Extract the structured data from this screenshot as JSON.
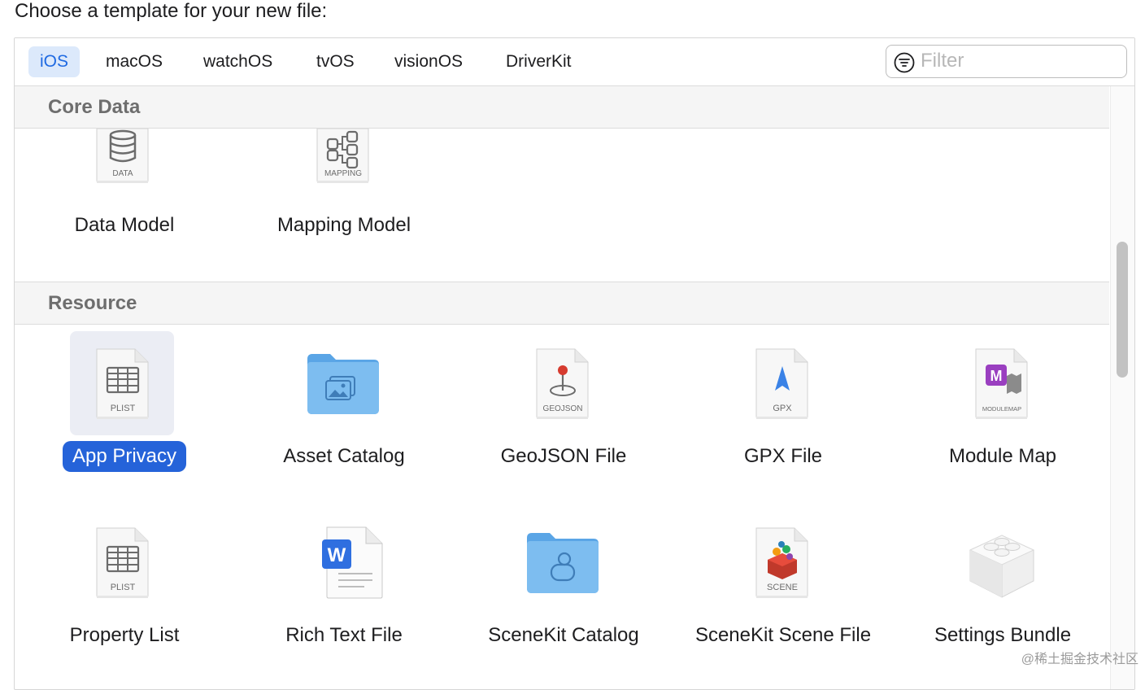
{
  "heading": "Choose a template for your new file:",
  "platform_tabs": [
    {
      "label": "iOS",
      "selected": true
    },
    {
      "label": "macOS",
      "selected": false
    },
    {
      "label": "watchOS",
      "selected": false
    },
    {
      "label": "tvOS",
      "selected": false
    },
    {
      "label": "visionOS",
      "selected": false
    },
    {
      "label": "DriverKit",
      "selected": false
    }
  ],
  "filter": {
    "placeholder": "Filter",
    "value": ""
  },
  "sections": [
    {
      "title": "Core Data",
      "items": [
        {
          "label": "Data Model",
          "icon": "data-document-icon",
          "icon_caption": "DATA"
        },
        {
          "label": "Mapping Model",
          "icon": "mapping-document-icon",
          "icon_caption": "MAPPING"
        }
      ]
    },
    {
      "title": "Resource",
      "items": [
        {
          "label": "App Privacy",
          "icon": "plist-document-icon",
          "icon_caption": "PLIST",
          "selected": true
        },
        {
          "label": "Asset Catalog",
          "icon": "asset-folder-icon"
        },
        {
          "label": "GeoJSON File",
          "icon": "geojson-document-icon",
          "icon_caption": "GEOJSON"
        },
        {
          "label": "GPX File",
          "icon": "gpx-document-icon",
          "icon_caption": "GPX"
        },
        {
          "label": "Module Map",
          "icon": "modulemap-document-icon",
          "icon_caption": "MODULEMAP"
        },
        {
          "label": "Property List",
          "icon": "plist-document-icon",
          "icon_caption": "PLIST"
        },
        {
          "label": "Rich Text File",
          "icon": "word-document-icon"
        },
        {
          "label": "SceneKit Catalog",
          "icon": "scenekit-folder-icon"
        },
        {
          "label": "SceneKit Scene File",
          "icon": "scene-document-icon",
          "icon_caption": "SCENE"
        },
        {
          "label": "Settings Bundle",
          "icon": "lego-brick-icon"
        }
      ]
    }
  ],
  "watermark": "@稀土掘金技术社区"
}
